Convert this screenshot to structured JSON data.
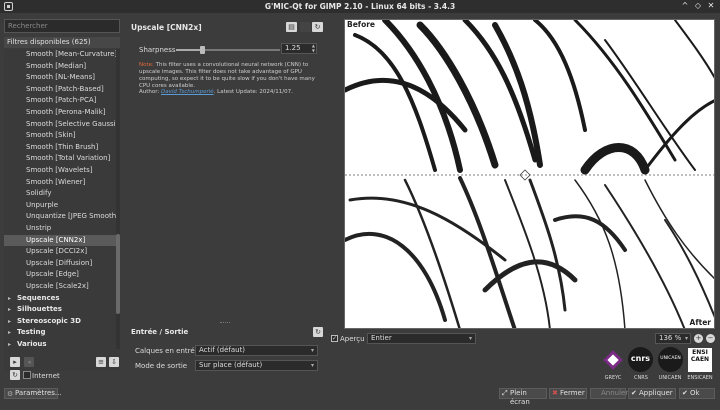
{
  "window": {
    "title": "G'MIC-Qt for GIMP 2.10 - Linux 64 bits - 3.4.3",
    "controls": [
      "^",
      "◇",
      "✕"
    ]
  },
  "left": {
    "search_placeholder": "Rechercher",
    "header": "Filtres disponibles (625)",
    "items": [
      {
        "label": "Smooth [Mean-Curvature]",
        "kind": "item",
        "selected": false
      },
      {
        "label": "Smooth [Median]",
        "kind": "item",
        "selected": false
      },
      {
        "label": "Smooth [NL-Means]",
        "kind": "item",
        "selected": false
      },
      {
        "label": "Smooth [Patch-Based]",
        "kind": "item",
        "selected": false
      },
      {
        "label": "Smooth [Patch-PCA]",
        "kind": "item",
        "selected": false
      },
      {
        "label": "Smooth [Perona-Malik]",
        "kind": "item",
        "selected": false
      },
      {
        "label": "Smooth [Selective Gaussian]",
        "kind": "item",
        "selected": false
      },
      {
        "label": "Smooth [Skin]",
        "kind": "item",
        "selected": false
      },
      {
        "label": "Smooth [Thin Brush]",
        "kind": "item",
        "selected": false
      },
      {
        "label": "Smooth [Total Variation]",
        "kind": "item",
        "selected": false
      },
      {
        "label": "Smooth [Wavelets]",
        "kind": "item",
        "selected": false
      },
      {
        "label": "Smooth [Wiener]",
        "kind": "item",
        "selected": false
      },
      {
        "label": "Solidify",
        "kind": "item",
        "selected": false
      },
      {
        "label": "Unpurple",
        "kind": "item",
        "selected": false
      },
      {
        "label": "Unquantize [JPEG Smooth]",
        "kind": "item",
        "selected": false
      },
      {
        "label": "Unstrip",
        "kind": "item",
        "selected": false
      },
      {
        "label": "Upscale [CNN2x]",
        "kind": "item",
        "selected": true
      },
      {
        "label": "Upscale [DCCI2x]",
        "kind": "item",
        "selected": false
      },
      {
        "label": "Upscale [Diffusion]",
        "kind": "item",
        "selected": false
      },
      {
        "label": "Upscale [Edge]",
        "kind": "item",
        "selected": false
      },
      {
        "label": "Upscale [Scale2x]",
        "kind": "item",
        "selected": false
      },
      {
        "label": "Sequences",
        "kind": "cat",
        "selected": false
      },
      {
        "label": "Silhouettes",
        "kind": "cat",
        "selected": false
      },
      {
        "label": "Stereoscopic 3D",
        "kind": "cat",
        "selected": false
      },
      {
        "label": "Testing",
        "kind": "cat",
        "selected": false
      },
      {
        "label": "Various",
        "kind": "cat",
        "selected": false
      }
    ],
    "internet_label": "Internet",
    "settings_button": "Paramètres..."
  },
  "filter": {
    "title": "Upscale [CNN2x]",
    "param_label": "Sharpness",
    "param_value": "1.25",
    "param_fraction": 0.25,
    "note_prefix": "Note:",
    "note_text": " This filter uses a convolutional neural network (CNN) to upscale images. This filter does not take advantage of GPU computing, so expect it to be quite slow if you don't have many CPU cores available.",
    "author_label": "Author:",
    "author_name": "David Tschumperlé",
    "update_text": ".      Latest Update: 2024/11/07."
  },
  "io": {
    "title": "Entrée / Sortie",
    "input_label": "Calques en entrée",
    "input_value": "Actif (défaut)",
    "output_label": "Mode de sortie",
    "output_value": "Sur place (défaut)"
  },
  "preview": {
    "before_label": "Before",
    "after_label": "After",
    "apercu_label": "Aperçu",
    "mode_value": "Entier",
    "zoom_value": "136 %"
  },
  "logos": [
    {
      "name": "GREYC"
    },
    {
      "name": "CNRS"
    },
    {
      "name": "UNICAEN"
    },
    {
      "name": "ENSICAEN",
      "text": "ENSI CAEN"
    }
  ],
  "buttons": {
    "fullscreen": "Plein écran",
    "close": "Fermer",
    "cancel": "Annuler",
    "apply": "Appliquer",
    "ok": "Ok"
  }
}
